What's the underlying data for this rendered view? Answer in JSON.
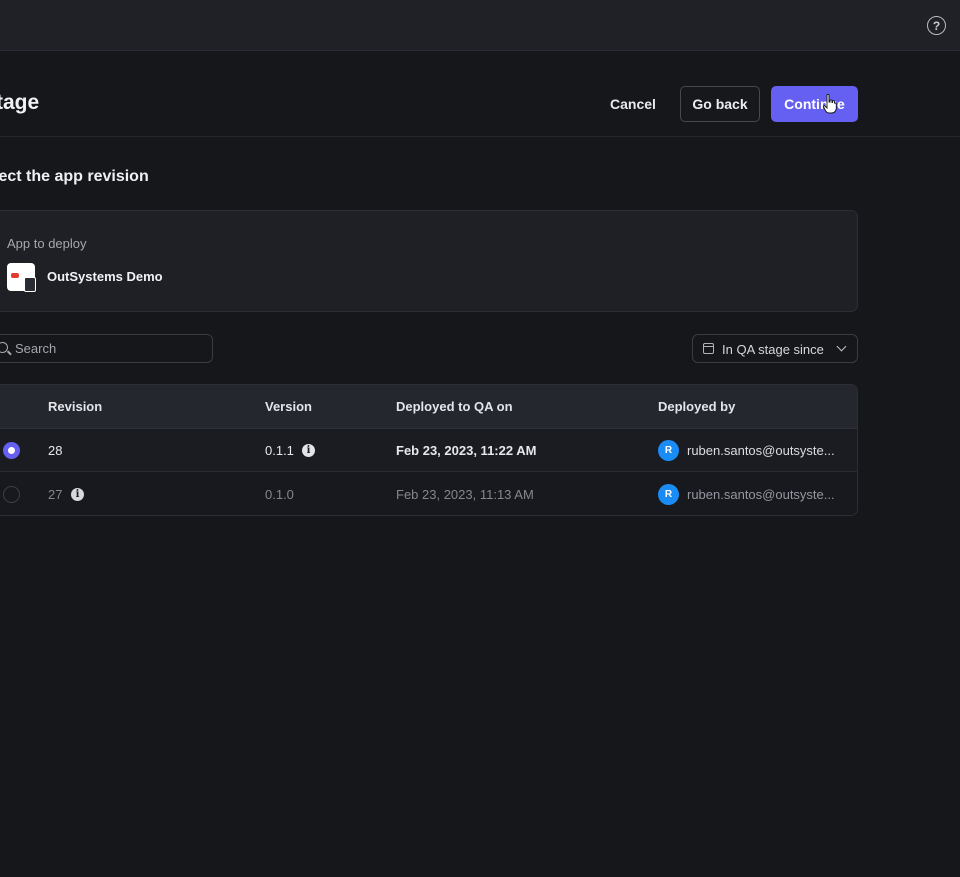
{
  "topbar": {
    "help_icon": "question-circle-icon",
    "help_glyph": "?"
  },
  "header": {
    "title": "tage",
    "cancel_label": "Cancel",
    "go_back_label": "Go back",
    "continue_label": "Continue",
    "accent_color": "#6660f2"
  },
  "section": {
    "title": "lect the app revision"
  },
  "app_card": {
    "label": "App to deploy",
    "app_name": "OutSystems Demo",
    "app_icon": "app-logo-icon"
  },
  "search": {
    "placeholder": "Search",
    "value": ""
  },
  "filter": {
    "label": "In QA stage since",
    "icon": "calendar-icon"
  },
  "table": {
    "headers": [
      "Revision",
      "Version",
      "Deployed to QA on",
      "Deployed by"
    ],
    "rows": [
      {
        "selected": true,
        "revision": "28",
        "version": "0.1.1",
        "deployed_on": "Feb 23, 2023, 11:22 AM",
        "avatar": "R",
        "deployed_by": "ruben.santos@outsyste..."
      },
      {
        "selected": false,
        "revision": "27",
        "version": "0.1.0",
        "deployed_on": "Feb 23, 2023, 11:13 AM",
        "avatar": "R",
        "deployed_by": "ruben.santos@outsyste..."
      }
    ],
    "info_glyph": "i"
  }
}
